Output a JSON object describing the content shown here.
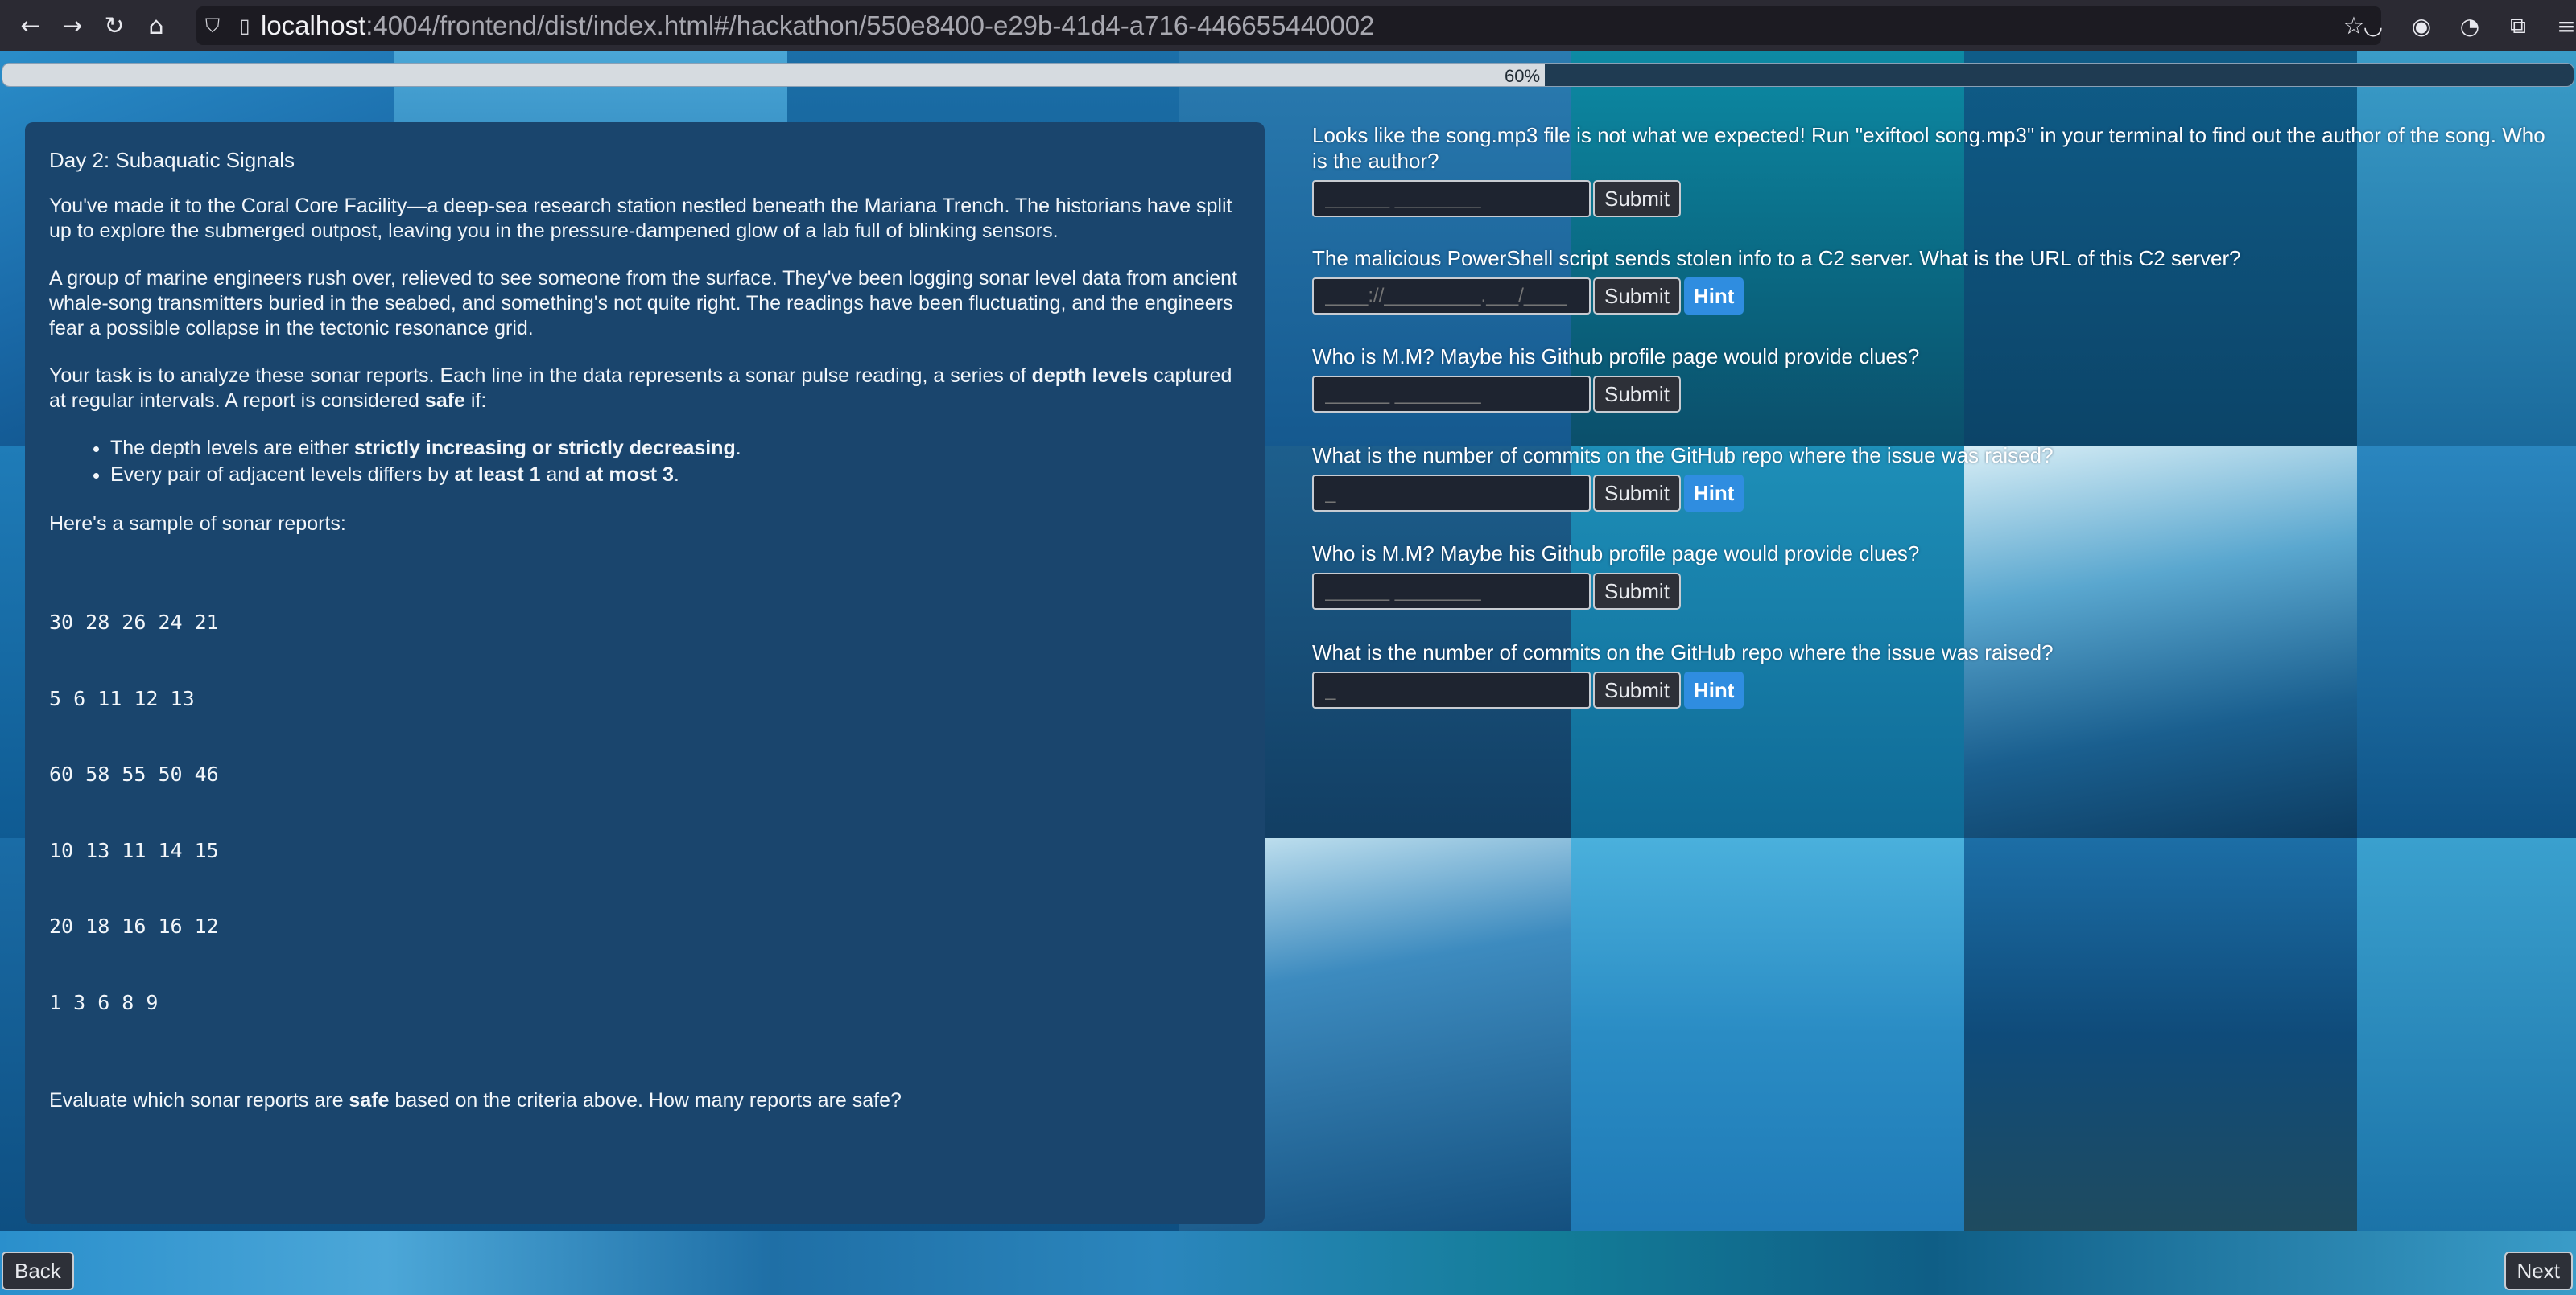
{
  "browser": {
    "url_host": "localhost",
    "url_path": ":4004/frontend/dist/index.html#/hackathon/550e8400-e29b-41d4-a716-446655440002",
    "icons": [
      "back-arrow-icon",
      "forward-arrow-icon",
      "reload-icon",
      "home-icon",
      "shield-icon",
      "page-icon",
      "bookmark-star-icon",
      "pocket-icon",
      "account-icon",
      "extension-mask-icon",
      "extensions-icon",
      "menu-icon"
    ]
  },
  "progress": {
    "label": "60%",
    "value": 0.6
  },
  "story": {
    "title": "Day 2: Subaquatic Signals",
    "p1": "You've made it to the Coral Core Facility—a deep-sea research station nestled beneath the Mariana Trench. The historians have split up to explore the submerged outpost, leaving you in the pressure-dampened glow of a lab full of blinking sensors.",
    "p2": "A group of marine engineers rush over, relieved to see someone from the surface. They've been logging sonar level data from ancient whale-song transmitters buried in the seabed, and something's not quite right. The readings have been fluctuating, and the engineers fear a possible collapse in the tectonic resonance grid.",
    "p3_a": "Your task is to analyze these sonar reports. Each line in the data represents a sonar pulse reading, a series of ",
    "p3_b": "depth levels",
    "p3_c": " captured at regular intervals. A report is considered ",
    "p3_d": "safe",
    "p3_e": " if:",
    "bullet1_a": "The depth levels are either ",
    "bullet1_b": "strictly increasing or strictly decreasing",
    "bullet1_c": ".",
    "bullet2_a": "Every pair of adjacent levels differs by ",
    "bullet2_b": "at least 1",
    "bullet2_c": " and ",
    "bullet2_d": "at most 3",
    "bullet2_e": ".",
    "sample_intro": "Here's a sample of sonar reports:",
    "sample_lines": [
      "30 28 26 24 21",
      "5 6 11 12 13",
      "60 58 55 50 46",
      "10 13 11 14 15",
      "20 18 16 16 12",
      "1 3 6 8 9"
    ],
    "closing_a": "Evaluate which sonar reports are ",
    "closing_b": "safe",
    "closing_c": " based on the criteria above. How many reports are safe?"
  },
  "questions": [
    {
      "text": "Looks like the song.mp3 file is not what we expected! Run \"exiftool song.mp3\" in your terminal to find out the author of the song. Who is the author?",
      "placeholder": "______ ________",
      "submit": "Submit",
      "hint": ""
    },
    {
      "text": "The malicious PowerShell script sends stolen info to a C2 server. What is the URL of this C2 server?",
      "placeholder": "____://_________.___/____",
      "submit": "Submit",
      "hint": "Hint"
    },
    {
      "text": "Who is M.M? Maybe his Github profile page would provide clues?",
      "placeholder": "______ ________",
      "submit": "Submit",
      "hint": ""
    },
    {
      "text": "What is the number of commits on the GitHub repo where the issue was raised?",
      "placeholder": "_",
      "submit": "Submit",
      "hint": "Hint"
    },
    {
      "text": "Who is M.M? Maybe his Github profile page would provide clues?",
      "placeholder": "______ ________",
      "submit": "Submit",
      "hint": ""
    },
    {
      "text": "What is the number of commits on the GitHub repo where the issue was raised?",
      "placeholder": "_",
      "submit": "Submit",
      "hint": "Hint"
    }
  ],
  "nav": {
    "back": "Back",
    "next": "Next"
  }
}
